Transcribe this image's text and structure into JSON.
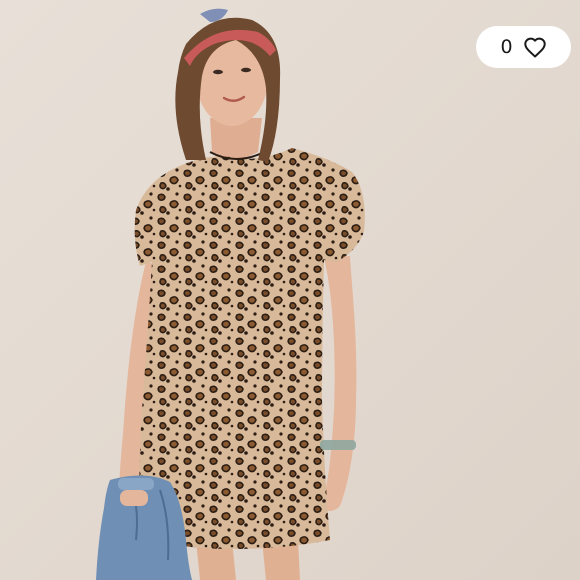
{
  "listing": {
    "like_count": "0",
    "like_icon": "heart-outline-icon"
  },
  "photo": {
    "subject": "model-in-leopard-print-dress",
    "background_color": "#e4dbd3",
    "dress_base_color": "#d8b999",
    "spot_dark_color": "#2b1d14",
    "spot_brown_color": "#7a4e2a",
    "skin_color": "#e4b69b",
    "hair_color": "#6e4a30",
    "denim_color": "#6f8fb4"
  }
}
